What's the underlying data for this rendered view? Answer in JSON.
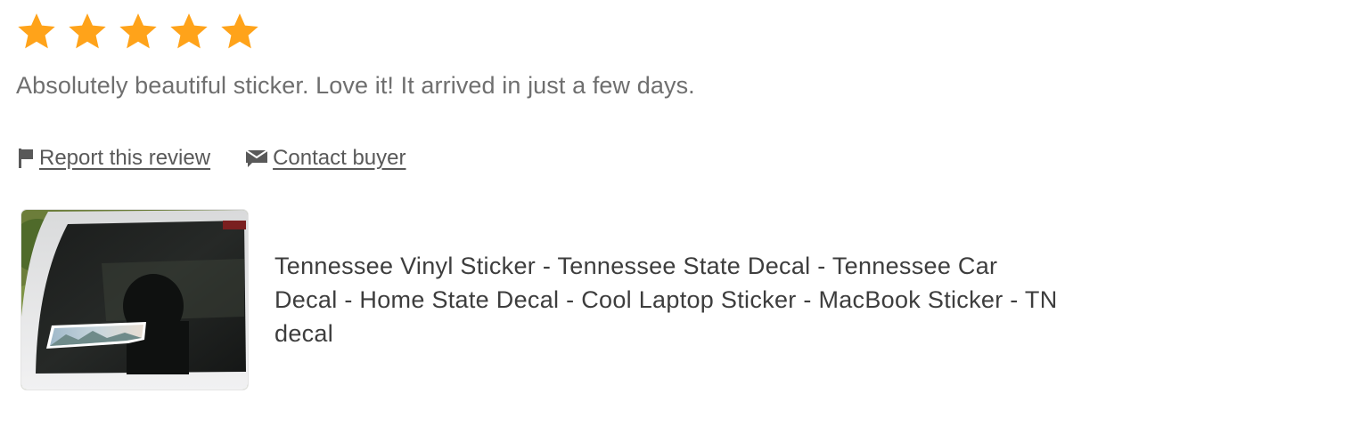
{
  "review": {
    "rating": 5,
    "rating_max": 5,
    "star_color": "#ffa31a",
    "text": "Absolutely beautiful sticker. Love it! It arrived in just a few days."
  },
  "actions": {
    "report_icon": "flag-icon",
    "report_label": "Report this review",
    "contact_icon": "envelope-icon",
    "contact_label": "Contact buyer"
  },
  "item": {
    "title": "Tennessee Vinyl Sticker - Tennessee State Decal - Tennessee Car Decal - Home State Decal - Cool Laptop Sticker - MacBook Sticker - TN decal"
  }
}
